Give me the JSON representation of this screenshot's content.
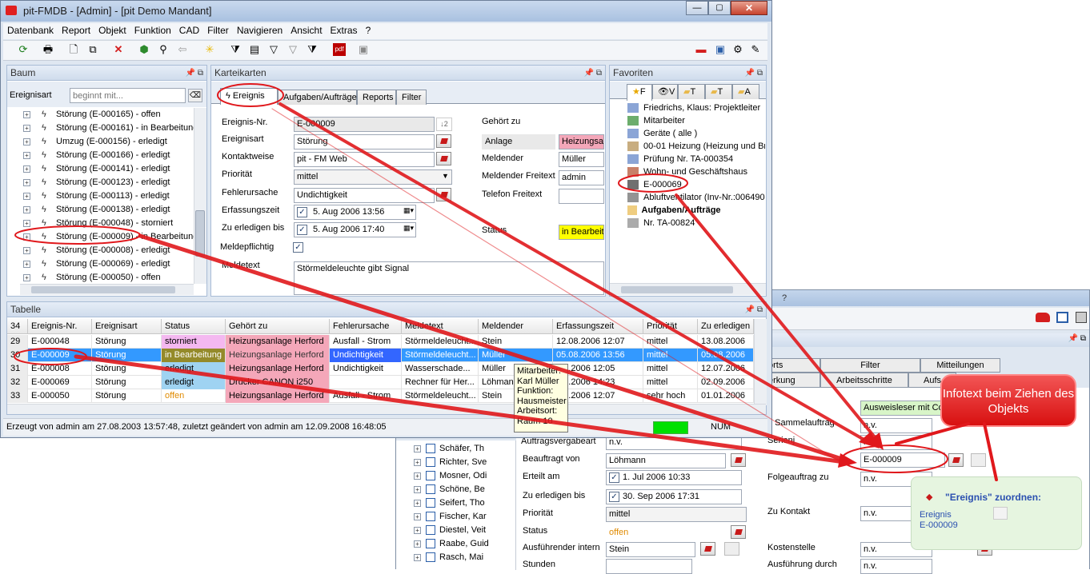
{
  "window": {
    "title": "pit-FMDB - [Admin] - [pit Demo Mandant]",
    "menu": [
      "Datenbank",
      "Report",
      "Objekt",
      "Funktion",
      "CAD",
      "Filter",
      "Navigieren",
      "Ansicht",
      "Extras",
      "?"
    ]
  },
  "tree": {
    "title": "Baum",
    "filter_label": "Ereignisart",
    "filter_placeholder": "beginnt mit...",
    "items": [
      "Störung (E-000165) - offen",
      "Störung (E-000161) - in Bearbeitung",
      "Umzug (E-000156) - erledigt",
      "Störung (E-000166) - erledigt",
      "Störung (E-000141) - erledigt",
      "Störung (E-000123) - erledigt",
      "Störung (E-000113) - erledigt",
      "Störung (E-000138) - erledigt",
      "Störung (E-000048) - storniert",
      "Störung (E-000009) - in Bearbeitung",
      "Störung (E-000008) - erledigt",
      "Störung (E-000069) - erledigt",
      "Störung (E-000050) - offen"
    ]
  },
  "card": {
    "title": "Karteikarten",
    "tabs": [
      "Ereignis",
      "Aufgaben/Aufträge",
      "Reports",
      "Filter"
    ],
    "labels": {
      "nr": "Ereignis-Nr.",
      "art": "Ereignisart",
      "kontakt": "Kontaktweise",
      "prio": "Priorität",
      "ursache": "Fehlerursache",
      "erfassung": "Erfassungszeit",
      "bis": "Zu erledigen bis",
      "melde": "Meldepflichtig",
      "text": "Meldetext",
      "gehoert": "Gehört zu",
      "meldender": "Meldender",
      "meldender_frei": "Meldender Freitext",
      "telefon": "Telefon Freitext",
      "status": "Status"
    },
    "values": {
      "nr": "E-000009",
      "art": "Störung",
      "kontakt": "pit - FM Web",
      "prio": "mittel",
      "ursache": "Undichtigkeit",
      "erfassung": "5. Aug 2006 13:56",
      "bis": "5. Aug 2006 17:40",
      "text": "Störmeldeleuchte gibt Signal",
      "anlage": "Anlage",
      "anlage_val": "Heizungsar",
      "meldender": "Müller",
      "meldender_frei": "admin",
      "status": "in Bearbeitu"
    }
  },
  "favorites": {
    "title": "Favoriten",
    "tabs": [
      "F",
      "V",
      "T",
      "T",
      "A"
    ],
    "items": [
      "Friedrichs, Klaus: Projektleiter",
      "Mitarbeiter",
      "Geräte ( alle )",
      "00-01 Heizung (Heizung und Brau",
      "Prüfung Nr. TA-000354",
      "Wohn- und Geschäftshaus",
      "E-000069",
      "Abluftventilator (Inv-Nr.:0064900",
      "Aufgaben/Aufträge",
      "Nr. TA-00824"
    ]
  },
  "table": {
    "title": "Tabelle",
    "count": "34",
    "columns": [
      "Ereignis-Nr.",
      "Ereignisart",
      "Status",
      "Gehört zu",
      "Fehlerursache",
      "Meldetext",
      "Meldender",
      "Erfassungszeit",
      "Priorität",
      "Zu erledigen"
    ],
    "rows": [
      [
        "29",
        "E-000048",
        "Störung",
        "storniert",
        "Heizungsanlage Herford",
        "Ausfall - Strom",
        "Störmeldeleucht...",
        "Stein",
        "12.08.2006 12:07",
        "mittel",
        "13.08.2006"
      ],
      [
        "30",
        "E-000009",
        "Störung",
        "in Bearbeitung",
        "Heizungsanlage Herford",
        "Undichtigkeit",
        "Störmeldeleucht...",
        "Müller",
        "05.08.2006 13:56",
        "mittel",
        "05.08.2006"
      ],
      [
        "31",
        "E-000008",
        "Störung",
        "erledigt",
        "Heizungsanlage Herford",
        "Undichtigkeit",
        "Wasserschade...",
        "Müller",
        ".07.2006 12:05",
        "mittel",
        "12.07.2006"
      ],
      [
        "32",
        "E-000069",
        "Störung",
        "erledigt",
        "Drucker CANON i250",
        "",
        "Rechner für Her...",
        "Löhmann",
        ".07.2006 14:23",
        "mittel",
        "02.09.2006"
      ],
      [
        "33",
        "E-000050",
        "Störung",
        "offen",
        "Heizungsanlage Herford",
        "Ausfall - Strom",
        "Störmeldeleucht...",
        "Stein",
        ".01.2006 12:07",
        "sehr hoch",
        "01.01.2006"
      ]
    ],
    "tooltip": [
      "Mitarbeiter:",
      "Karl Müller",
      "Funktion:",
      "Hausmeister",
      "Arbeitsort:",
      "Raum 10"
    ]
  },
  "statusbar": {
    "text": "Erzeugt von admin am 27.08.2003 13:57:48, zuletzt geändert von admin am 12.09.2008 16:48:05",
    "num": "NUM"
  },
  "second": {
    "question": "?",
    "tabs_row1": [
      "orts",
      "Filter",
      "Mitteilungen"
    ],
    "tabs_row2": [
      "erkung",
      "Arbeitsschritte",
      "Aufs"
    ],
    "ausweis": "Ausweisleser mit Coo",
    "sammel_label": "u Sammelauftrag",
    "tree_items": [
      "Schäfer, Th",
      "Richter, Sve",
      "Mosner, Odi",
      "Schöne, Be",
      "Seifert, Tho",
      "Fischer, Kar",
      "Diestel, Veit",
      "Raabe, Guid",
      "Rasch, Mai"
    ],
    "labels": {
      "auftrag": "Auftragsvergabeart",
      "beauftragt": "Beauftragt von",
      "erteilt": "Erteilt am",
      "bis": "Zu erledigen bis",
      "prio": "Priorität",
      "status": "Status",
      "ausf": "Ausführender intern",
      "stunden": "Stunden",
      "folge": "Folgeauftrag zu",
      "kontakt": "Zu Kontakt",
      "kosten": "Kostenstelle",
      "ausf_durch": "Ausführung durch",
      "serien": "Serienj"
    },
    "values": {
      "auftrag": "n.v.",
      "beauftragt": "Löhmann",
      "erteilt": "1.  Jul  2006 10:33",
      "bis": "30. Sep 2006 17:31",
      "prio": "mittel",
      "status": "offen",
      "ausf": "Stein",
      "nv": "n.v.",
      "drop": "E-000009"
    }
  },
  "callout": {
    "text": "Infotext beim Ziehen des Objekts"
  },
  "assign": {
    "title": "\"Ereignis\" zuordnen:",
    "line1": "Ereignis",
    "line2": "E-000009"
  },
  "colors": {
    "accent_red": "#e0181c",
    "selection": "#3399ff",
    "pink": "#f4a7b9",
    "olive": "#948a2a",
    "blue_light": "#9fd3f2",
    "yellow": "#ffff00",
    "green": "#00e000"
  }
}
